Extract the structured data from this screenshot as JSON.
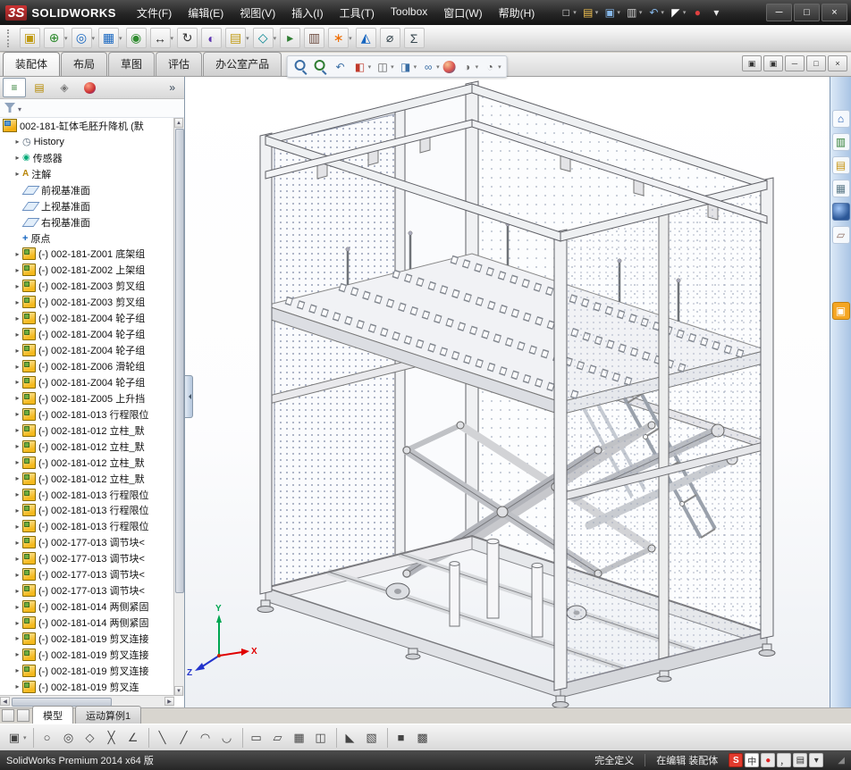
{
  "titlebar": {
    "logo": {
      "mark": "3S",
      "text": "SOLIDWORKS"
    },
    "quick_icons": [
      {
        "name": "new-document-icon",
        "glyph": "□",
        "caret": "caret"
      },
      {
        "name": "open-icon",
        "glyph": "▤",
        "caret": "caret"
      },
      {
        "name": "save-icon",
        "glyph": "▣",
        "caret": "caret"
      },
      {
        "name": "print-icon",
        "glyph": "▥",
        "caret": "caret"
      },
      {
        "name": "undo-icon",
        "glyph": "↶",
        "caret": "caret"
      },
      {
        "name": "select-icon",
        "glyph": "◤",
        "caret": "caret"
      },
      {
        "name": "red-status-icon",
        "glyph": "●"
      },
      {
        "name": "toolbar-options-icon",
        "glyph": "▾"
      }
    ],
    "window_controls": [
      {
        "name": "minimize-button",
        "glyph": "─"
      },
      {
        "name": "maximize-button",
        "glyph": "□"
      },
      {
        "name": "close-button",
        "glyph": "×"
      }
    ]
  },
  "menubar": {
    "items": [
      {
        "label": "文件(F)"
      },
      {
        "label": "编辑(E)"
      },
      {
        "label": "视图(V)"
      },
      {
        "label": "插入(I)"
      },
      {
        "label": "工具(T)"
      },
      {
        "label": "Toolbox"
      },
      {
        "label": "窗口(W)"
      },
      {
        "label": "帮助(H)"
      }
    ]
  },
  "assembly_toolbar": {
    "icons": [
      {
        "name": "edit-component-icon",
        "glyph": "▣"
      },
      {
        "name": "insert-components-icon",
        "glyph": "⊕",
        "caret": "caret"
      },
      {
        "name": "mate-icon",
        "glyph": "◎",
        "caret": "caret"
      },
      {
        "name": "linear-component-pattern-icon",
        "glyph": "▦",
        "caret": "caret"
      },
      {
        "name": "smart-fasteners-icon",
        "glyph": "◉"
      },
      {
        "name": "move-component-icon",
        "glyph": "↔",
        "caret": "caret"
      },
      {
        "name": "rotate-component-icon",
        "glyph": "↻"
      },
      {
        "name": "show-hidden-components-icon",
        "glyph": "◐"
      },
      {
        "name": "assembly-features-icon",
        "glyph": "▤",
        "caret": "caret"
      },
      {
        "name": "reference-geometry-icon",
        "glyph": "◇",
        "caret": "caret"
      },
      {
        "name": "new-motion-study-icon",
        "glyph": "▸"
      },
      {
        "name": "bill-of-materials-icon",
        "glyph": "▥"
      },
      {
        "name": "exploded-view-icon",
        "glyph": "∗",
        "caret": "caret"
      },
      {
        "name": "interference-detection-icon",
        "glyph": "◭"
      },
      {
        "name": "measure-icon",
        "glyph": "⌀"
      },
      {
        "name": "mass-properties-icon",
        "glyph": "Σ"
      }
    ]
  },
  "command_tabs": {
    "tabs": [
      {
        "label": "装配体",
        "state": "active"
      },
      {
        "label": "布局",
        "state": "idle"
      },
      {
        "label": "草图",
        "state": "idle"
      },
      {
        "label": "评估",
        "state": "idle"
      },
      {
        "label": "办公室产品",
        "state": "idle"
      }
    ]
  },
  "headsup": {
    "icons": [
      {
        "name": "zoom-fit-icon",
        "glyph": ""
      },
      {
        "name": "zoom-area-icon",
        "glyph": ""
      },
      {
        "name": "previous-view-icon",
        "glyph": "↶"
      },
      {
        "name": "section-view-icon",
        "glyph": "◧",
        "caret": "caret"
      },
      {
        "name": "view-orientation-icon",
        "glyph": "◫",
        "caret": "caret"
      },
      {
        "name": "display-style-icon",
        "glyph": "◨",
        "caret": "caret"
      },
      {
        "name": "hide-show-items-icon",
        "glyph": "∞",
        "caret": "caret"
      },
      {
        "name": "edit-appearance-icon",
        "glyph": ""
      },
      {
        "name": "apply-scene-icon",
        "glyph": "◑",
        "caret": "caret"
      },
      {
        "name": "view-settings-icon",
        "glyph": "◔",
        "caret": "caret"
      }
    ]
  },
  "doc_window_controls": {
    "buttons": [
      {
        "name": "doc-previous-window-icon",
        "glyph": "▣"
      },
      {
        "name": "doc-next-window-icon",
        "glyph": "▣"
      },
      {
        "name": "doc-minimize-icon",
        "glyph": "─"
      },
      {
        "name": "doc-restore-icon",
        "glyph": "□"
      },
      {
        "name": "doc-close-icon",
        "glyph": "×"
      }
    ]
  },
  "feature_panel": {
    "tabs": [
      {
        "name": "featuremanager-tab-icon",
        "glyph": "≡",
        "state": "sel"
      },
      {
        "name": "propertymanager-tab-icon",
        "glyph": "▤",
        "state": "idle"
      },
      {
        "name": "configurationmanager-tab-icon",
        "glyph": "◈",
        "state": "idle"
      },
      {
        "name": "displaymanager-tab-icon",
        "glyph": "",
        "state": "idle"
      }
    ],
    "expand_label": "»",
    "tree": {
      "root": {
        "label": "002-181-缸体毛胚升降机 (默",
        "exp": ""
      },
      "items": [
        {
          "icon": "history-icon",
          "glyph": "◷",
          "label": "History",
          "exp": "▸"
        },
        {
          "icon": "sensors-icon",
          "glyph": "◉",
          "label": "传感器",
          "exp": "▸"
        },
        {
          "icon": "annotations-icon",
          "glyph": "A",
          "label": "注解",
          "exp": "▸"
        },
        {
          "icon": "plane-icon",
          "glyph": "",
          "label": "前视基准面",
          "exp": ""
        },
        {
          "icon": "plane-icon",
          "glyph": "",
          "label": "上视基准面",
          "exp": ""
        },
        {
          "icon": "plane-icon",
          "glyph": "",
          "label": "右视基准面",
          "exp": ""
        },
        {
          "icon": "origin-icon",
          "glyph": "+",
          "label": "原点",
          "exp": ""
        },
        {
          "icon": "component-icon",
          "glyph": "",
          "label": "(-) 002-181-Z001 底架组",
          "exp": "▸"
        },
        {
          "icon": "component-icon",
          "glyph": "",
          "label": "(-) 002-181-Z002 上架组",
          "exp": "▸"
        },
        {
          "icon": "component-icon",
          "glyph": "",
          "label": "(-) 002-181-Z003 剪叉组",
          "exp": "▸"
        },
        {
          "icon": "component-icon",
          "glyph": "",
          "label": "(-) 002-181-Z003 剪叉组",
          "exp": "▸"
        },
        {
          "icon": "component-icon",
          "glyph": "",
          "label": "(-) 002-181-Z004 轮子组",
          "exp": "▸"
        },
        {
          "icon": "component-icon",
          "glyph": "",
          "label": "(-) 002-181-Z004 轮子组",
          "exp": "▸"
        },
        {
          "icon": "component-icon",
          "glyph": "",
          "label": "(-) 002-181-Z004 轮子组",
          "exp": "▸"
        },
        {
          "icon": "component-icon",
          "glyph": "",
          "label": "(-) 002-181-Z006 滑轮组",
          "exp": "▸"
        },
        {
          "icon": "component-icon",
          "glyph": "",
          "label": "(-) 002-181-Z004 轮子组",
          "exp": "▸"
        },
        {
          "icon": "component-icon",
          "glyph": "",
          "label": "(-) 002-181-Z005 上升挡",
          "exp": "▸"
        },
        {
          "icon": "component-icon",
          "glyph": "",
          "label": "(-) 002-181-013 行程限位",
          "exp": "▸"
        },
        {
          "icon": "component-icon",
          "glyph": "",
          "label": "(-) 002-181-012 立柱_默",
          "exp": "▸"
        },
        {
          "icon": "component-icon",
          "glyph": "",
          "label": "(-) 002-181-012 立柱_默",
          "exp": "▸"
        },
        {
          "icon": "component-icon",
          "glyph": "",
          "label": "(-) 002-181-012 立柱_默",
          "exp": "▸"
        },
        {
          "icon": "component-icon",
          "glyph": "",
          "label": "(-) 002-181-012 立柱_默",
          "exp": "▸"
        },
        {
          "icon": "component-icon",
          "glyph": "",
          "label": "(-) 002-181-013 行程限位",
          "exp": "▸"
        },
        {
          "icon": "component-icon",
          "glyph": "",
          "label": "(-) 002-181-013 行程限位",
          "exp": "▸"
        },
        {
          "icon": "component-icon",
          "glyph": "",
          "label": "(-) 002-181-013 行程限位",
          "exp": "▸"
        },
        {
          "icon": "component-icon",
          "glyph": "",
          "label": "(-) 002-177-013 调节块<",
          "exp": "▸"
        },
        {
          "icon": "component-icon",
          "glyph": "",
          "label": "(-) 002-177-013 调节块<",
          "exp": "▸"
        },
        {
          "icon": "component-icon",
          "glyph": "",
          "label": "(-) 002-177-013 调节块<",
          "exp": "▸"
        },
        {
          "icon": "component-icon",
          "glyph": "",
          "label": "(-) 002-177-013 调节块<",
          "exp": "▸"
        },
        {
          "icon": "component-icon",
          "glyph": "",
          "label": "(-) 002-181-014 两侧紧固",
          "exp": "▸"
        },
        {
          "icon": "component-icon",
          "glyph": "",
          "label": "(-) 002-181-014 两侧紧固",
          "exp": "▸"
        },
        {
          "icon": "component-icon",
          "glyph": "",
          "label": "(-) 002-181-019 剪叉连接",
          "exp": "▸"
        },
        {
          "icon": "component-icon",
          "glyph": "",
          "label": "(-) 002-181-019 剪叉连接",
          "exp": "▸"
        },
        {
          "icon": "component-icon",
          "glyph": "",
          "label": "(-) 002-181-019 剪叉连接",
          "exp": "▸"
        },
        {
          "icon": "component-icon",
          "glyph": "",
          "label": "(-) 002-181-019 剪叉连",
          "exp": "▸"
        }
      ]
    }
  },
  "taskpane": {
    "icons": [
      {
        "name": "solidworks-resources-icon",
        "glyph": "⌂"
      },
      {
        "name": "design-library-icon",
        "glyph": "▥"
      },
      {
        "name": "file-explorer-icon",
        "glyph": "▤"
      },
      {
        "name": "view-palette-icon",
        "glyph": "▦"
      },
      {
        "name": "appearances-icon",
        "glyph": ""
      },
      {
        "name": "custom-properties-icon",
        "glyph": "▱"
      },
      {
        "name": "forum-icon",
        "glyph": "▣"
      }
    ]
  },
  "viewport": {
    "triad": {
      "x_label": "X",
      "y_label": "Y",
      "z_label": "Z"
    }
  },
  "model_tabs": {
    "tabs": [
      {
        "label": "模型",
        "state": "active"
      },
      {
        "label": "运动算例1",
        "state": "idle"
      }
    ]
  },
  "sketch_toolbar": {
    "icons": [
      {
        "name": "sketch-save-icon",
        "glyph": "▣",
        "caret": "caret"
      },
      {
        "name": "circle-tool-icon",
        "glyph": "○",
        "sep": "sep"
      },
      {
        "name": "perimeter-circle-tool-icon",
        "glyph": "◎"
      },
      {
        "name": "polygon-tool-icon",
        "glyph": "◇"
      },
      {
        "name": "spline-tool-icon",
        "glyph": "╳"
      },
      {
        "name": "angle-tool-icon",
        "glyph": "∠"
      },
      {
        "name": "line-tool-icon",
        "glyph": "╲",
        "sep": "sep"
      },
      {
        "name": "centerline-tool-icon",
        "glyph": "╱"
      },
      {
        "name": "arc-tool-icon",
        "glyph": "◠"
      },
      {
        "name": "tangent-arc-tool-icon",
        "glyph": "◡"
      },
      {
        "name": "corner-rectangle-tool-icon",
        "glyph": "▭",
        "sep": "sep"
      },
      {
        "name": "parallelogram-tool-icon",
        "glyph": "▱"
      },
      {
        "name": "hatch-tool-icon",
        "glyph": "▦"
      },
      {
        "name": "mirror-tool-icon",
        "glyph": "◫"
      },
      {
        "name": "triangle-tool-icon",
        "glyph": "◣",
        "sep": "sep"
      },
      {
        "name": "wire-cube-icon",
        "glyph": "▧"
      },
      {
        "name": "shaded-cube-icon",
        "glyph": "■",
        "sep": "sep"
      },
      {
        "name": "grid-tool-icon",
        "glyph": "▩"
      }
    ]
  },
  "statusbar": {
    "product": "SolidWorks Premium 2014 x64 版",
    "definition_state": "完全定义",
    "editing_state": "在编辑 装配体",
    "ime": [
      {
        "name": "ime-sogou-icon",
        "glyph": "S"
      },
      {
        "name": "ime-mode-icon",
        "glyph": "中"
      },
      {
        "name": "ime-shape-icon",
        "glyph": "●"
      },
      {
        "name": "ime-punctuation-icon",
        "glyph": "，"
      },
      {
        "name": "ime-keyboard-icon",
        "glyph": "▤"
      },
      {
        "name": "ime-settings-icon",
        "glyph": "▾"
      }
    ]
  }
}
